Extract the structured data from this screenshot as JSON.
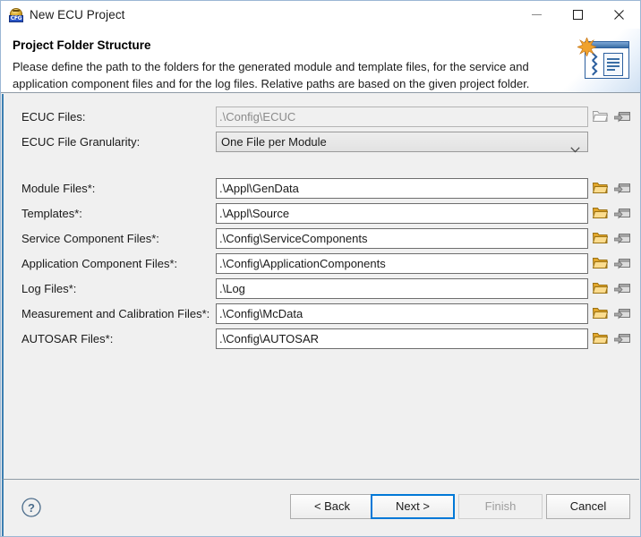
{
  "window": {
    "title": "New ECU Project",
    "app_icon": "cfg-ecu-icon",
    "icon_badge_text": "CFG",
    "controls": {
      "minimize": "minimize-icon",
      "maximize": "maximize-icon",
      "close": "close-icon"
    }
  },
  "header": {
    "title": "Project Folder Structure",
    "description": "Please define the path to the folders for the generated module and template files, for the service and application component files and for the log files. Relative paths are based on the given project folder.",
    "banner_icon": "wizard-banner-icon"
  },
  "form": {
    "ecuc_files": {
      "label": "ECUC Files:",
      "value": ".\\Config\\ECUC",
      "enabled": false,
      "browse_icon": "folder-open-icon",
      "variable_icon": "folder-variable-icon"
    },
    "granularity": {
      "label": "ECUC File Granularity:",
      "value": "One File per Module",
      "options": [
        "One File per Module"
      ],
      "chevron_icon": "chevron-down-icon"
    },
    "rows": [
      {
        "label": "Module Files*:",
        "value": ".\\Appl\\GenData",
        "browse_icon": "folder-open-icon",
        "variable_icon": "folder-variable-icon"
      },
      {
        "label": "Templates*:",
        "value": ".\\Appl\\Source",
        "browse_icon": "folder-open-icon",
        "variable_icon": "folder-variable-icon"
      },
      {
        "label": "Service Component Files*:",
        "value": ".\\Config\\ServiceComponents",
        "browse_icon": "folder-open-icon",
        "variable_icon": "folder-variable-icon"
      },
      {
        "label": "Application Component Files*:",
        "value": ".\\Config\\ApplicationComponents",
        "browse_icon": "folder-open-icon",
        "variable_icon": "folder-variable-icon"
      },
      {
        "label": "Log Files*:",
        "value": ".\\Log",
        "browse_icon": "folder-open-icon",
        "variable_icon": "folder-variable-icon"
      },
      {
        "label": "Measurement and Calibration Files*:",
        "value": ".\\Config\\McData",
        "browse_icon": "folder-open-icon",
        "variable_icon": "folder-variable-icon"
      },
      {
        "label": "AUTOSAR Files*:",
        "value": ".\\Config\\AUTOSAR",
        "browse_icon": "folder-open-icon",
        "variable_icon": "folder-variable-icon"
      }
    ]
  },
  "footer": {
    "help_icon": "help-question-icon",
    "buttons": {
      "back": "< Back",
      "next": "Next >",
      "finish": "Finish",
      "cancel": "Cancel"
    },
    "default_button": "Next >",
    "disabled_button": "Finish"
  },
  "colors": {
    "accent": "#0078d7",
    "panel": "#f0f0f0",
    "panel_border": "#3c7fb1",
    "folder_gold": "#e8b84b",
    "disabled_text": "#8a8a8a"
  }
}
